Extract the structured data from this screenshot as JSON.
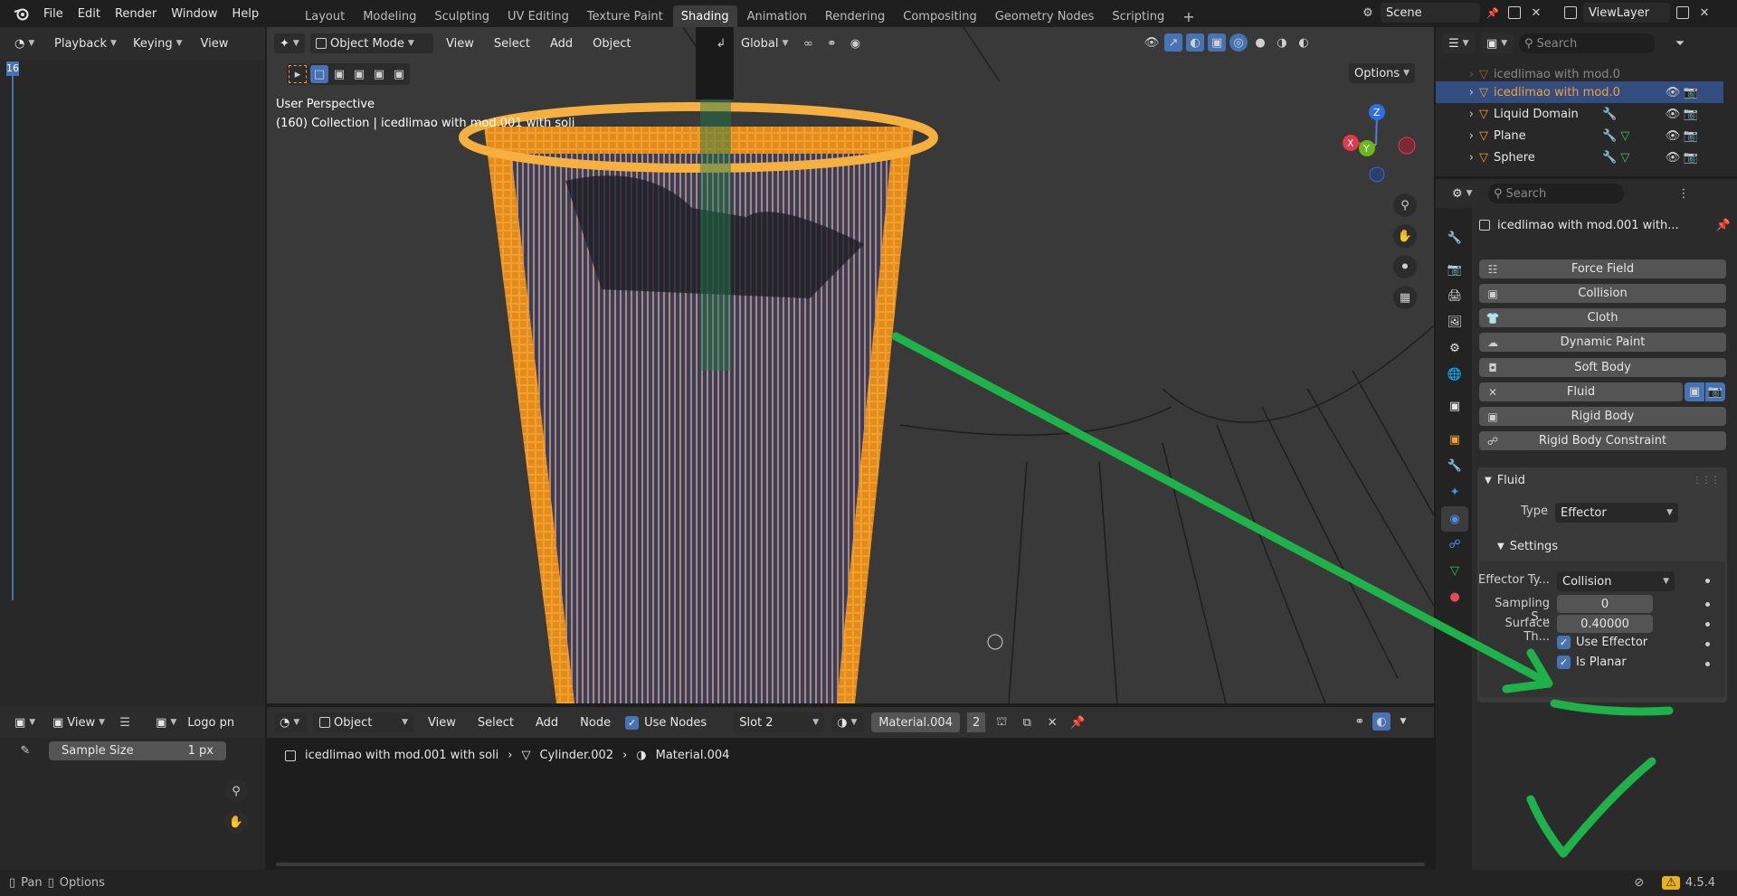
{
  "topbar": {
    "menus": [
      "File",
      "Edit",
      "Render",
      "Window",
      "Help"
    ],
    "workspaces": [
      "Layout",
      "Modeling",
      "Sculpting",
      "UV Editing",
      "Texture Paint",
      "Shading",
      "Animation",
      "Rendering",
      "Compositing",
      "Geometry Nodes",
      "Scripting"
    ],
    "active_workspace": "Shading",
    "scene": "Scene",
    "view_layer": "ViewLayer"
  },
  "timeline_header": {
    "playback": "Playback",
    "keying": "Keying",
    "view": "View",
    "frame_marker": "16"
  },
  "viewport": {
    "mode": "Object Mode",
    "menus": [
      "View",
      "Select",
      "Add",
      "Object"
    ],
    "orientation": "Global",
    "options": "Options",
    "perspective": "User Perspective",
    "collection_info": "(160) Collection | icedlimao with mod.001 with soli",
    "gizmo_axes": {
      "z": "Z",
      "x": "X",
      "y": "Y"
    }
  },
  "outliner": {
    "search_placeholder": "Search",
    "items": [
      {
        "name": "icedlimao with mod.0",
        "selected": false,
        "faded": true
      },
      {
        "name": "icedlimao with mod.0",
        "selected": true,
        "faded": false
      },
      {
        "name": "Liquid Domain",
        "selected": false,
        "faded": false
      },
      {
        "name": "Plane",
        "selected": false,
        "faded": false
      },
      {
        "name": "Sphere",
        "selected": false,
        "faded": false
      }
    ]
  },
  "properties": {
    "search_placeholder": "Search",
    "object_name": "icedlimao with mod.001 with...",
    "physics_buttons": [
      "Force Field",
      "Collision",
      "Cloth",
      "Dynamic Paint",
      "Soft Body",
      "Fluid",
      "Rigid Body",
      "Rigid Body Constraint"
    ],
    "fluid_panel": {
      "title": "Fluid",
      "type_label": "Type",
      "type_value": "Effector",
      "settings_title": "Settings",
      "effector_type_label": "Effector Ty...",
      "effector_type_value": "Collision",
      "sampling_label": "Sampling S...",
      "sampling_value": "0",
      "surface_label": "Surface Th...",
      "surface_value": "0.40000",
      "use_effector_label": "Use Effector",
      "use_effector_checked": true,
      "is_planar_label": "Is Planar",
      "is_planar_checked": true
    }
  },
  "image_editor": {
    "view": "View",
    "image_name": "Logo pn",
    "sample_size_label": "Sample Size",
    "sample_size_value": "1 px"
  },
  "node_editor": {
    "object": "Object",
    "menus": [
      "View",
      "Select",
      "Add",
      "Node"
    ],
    "use_nodes": "Use Nodes",
    "slot": "Slot 2",
    "material": "Material.004",
    "users": "2",
    "breadcrumb": [
      "icedlimao with mod.001 with soli",
      "Cylinder.002",
      "Material.004"
    ]
  },
  "statusbar": {
    "pan": "Pan",
    "options": "Options",
    "version": "4.5.4"
  },
  "colors": {
    "accent": "#4772b3",
    "selected_row": "#334d80",
    "object_orange": "#f5a030",
    "annotation_green": "#1fb24a"
  }
}
